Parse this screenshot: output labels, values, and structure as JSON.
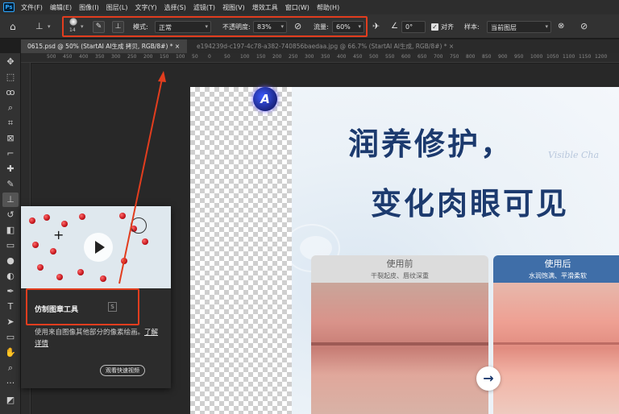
{
  "app": {
    "logo": "Ps"
  },
  "menu": [
    "文件(F)",
    "编辑(E)",
    "图像(I)",
    "图层(L)",
    "文字(Y)",
    "选择(S)",
    "滤镜(T)",
    "视图(V)",
    "增效工具",
    "窗口(W)",
    "帮助(H)"
  ],
  "options": {
    "brush_size": "14",
    "mode_label": "模式:",
    "mode_value": "正常",
    "opacity_label": "不透明度:",
    "opacity_value": "83%",
    "flow_label": "流量:",
    "flow_value": "60%",
    "angle_value": "0°",
    "align_label": "对齐",
    "sample_label": "样本:",
    "sample_value": "当前图层"
  },
  "tabs": [
    {
      "label": "0615.psd @ 50% (StartAI AI生成 拷贝, RGB/8#) *  ×",
      "active": true
    },
    {
      "label": "e194239d-c197-4c78-a382-740856baedaa.jpg @ 66.7% (StartAI AI生成, RGB/8#) *  ×",
      "active": false
    }
  ],
  "ruler_ticks": [
    "500",
    "450",
    "400",
    "350",
    "300",
    "250",
    "200",
    "150",
    "100",
    "50",
    "0",
    "50",
    "100",
    "150",
    "200",
    "250",
    "300",
    "350",
    "400",
    "450",
    "500",
    "550",
    "600",
    "650",
    "700",
    "750",
    "800",
    "850",
    "900",
    "950",
    "1000",
    "1050",
    "1100",
    "1150",
    "1200"
  ],
  "canvas": {
    "logo_letter": "A",
    "headline_1": "润养修护，",
    "headline_2": "变化肉眼可见",
    "script": "Visible Cha",
    "before": {
      "title": "使用前",
      "subtitle": "干裂起皮、唇纹深重"
    },
    "after": {
      "title": "使用后",
      "subtitle": "水润饱满、平滑柔软"
    },
    "arrow": "→"
  },
  "tooltip": {
    "tool_name": "仿制图章工具",
    "shortcut": "S",
    "description": "使用来自图像其他部分的像素绘画。",
    "learn_more": "了解详情",
    "video_button": "观看快速视频"
  },
  "colors": {
    "highlight": "#e23d1e",
    "headline": "#1c3a6e",
    "after_header": "#3f6ea8"
  }
}
